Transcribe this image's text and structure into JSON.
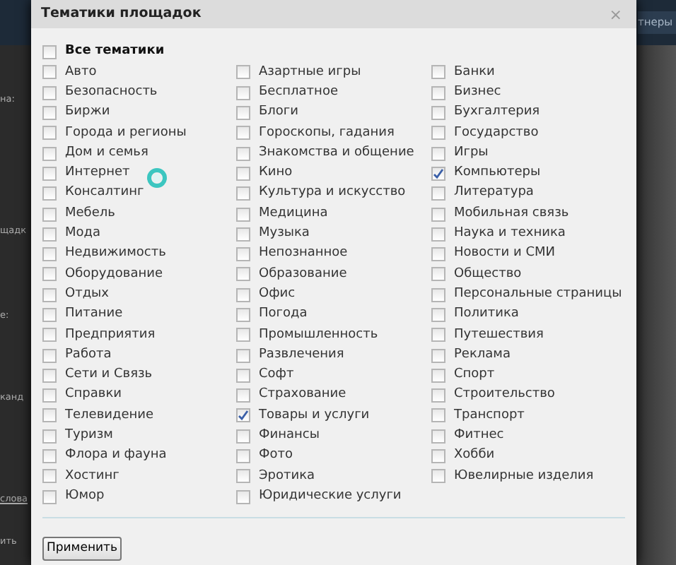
{
  "page": {
    "nav_tab": "тнеры",
    "side_labels": [
      "на:",
      "щадк",
      "е:",
      "канд",
      "слова",
      "ить"
    ]
  },
  "dialog": {
    "title": "Тематики площадок",
    "close": "×",
    "all": {
      "label": "Все тематики",
      "checked": false
    },
    "columns": [
      [
        {
          "label": "Авто",
          "checked": false
        },
        {
          "label": "Безопасность",
          "checked": false
        },
        {
          "label": "Биржи",
          "checked": false
        },
        {
          "label": "Города и регионы",
          "checked": false
        },
        {
          "label": "Дом и семья",
          "checked": false
        },
        {
          "label": "Интернет",
          "checked": false
        },
        {
          "label": "Консалтинг",
          "checked": false
        },
        {
          "label": "Мебель",
          "checked": false
        },
        {
          "label": "Мода",
          "checked": false
        },
        {
          "label": "Недвижимость",
          "checked": false
        },
        {
          "label": "Оборудование",
          "checked": false
        },
        {
          "label": "Отдых",
          "checked": false
        },
        {
          "label": "Питание",
          "checked": false
        },
        {
          "label": "Предприятия",
          "checked": false
        },
        {
          "label": "Работа",
          "checked": false
        },
        {
          "label": "Сети и Связь",
          "checked": false
        },
        {
          "label": "Справки",
          "checked": false
        },
        {
          "label": "Телевидение",
          "checked": false
        },
        {
          "label": "Туризм",
          "checked": false
        },
        {
          "label": "Флора и фауна",
          "checked": false
        },
        {
          "label": "Хостинг",
          "checked": false
        },
        {
          "label": "Юмор",
          "checked": false
        }
      ],
      [
        {
          "label": "Азартные игры",
          "checked": false
        },
        {
          "label": "Бесплатное",
          "checked": false
        },
        {
          "label": "Блоги",
          "checked": false
        },
        {
          "label": "Гороскопы, гадания",
          "checked": false
        },
        {
          "label": "Знакомства и общение",
          "checked": false
        },
        {
          "label": "Кино",
          "checked": false
        },
        {
          "label": "Культура и искусство",
          "checked": false
        },
        {
          "label": "Медицина",
          "checked": false
        },
        {
          "label": "Музыка",
          "checked": false
        },
        {
          "label": "Непознанное",
          "checked": false
        },
        {
          "label": "Образование",
          "checked": false
        },
        {
          "label": "Офис",
          "checked": false
        },
        {
          "label": "Погода",
          "checked": false
        },
        {
          "label": "Промышленность",
          "checked": false
        },
        {
          "label": "Развлечения",
          "checked": false
        },
        {
          "label": "Софт",
          "checked": false
        },
        {
          "label": "Страхование",
          "checked": false
        },
        {
          "label": "Товары и услуги",
          "checked": true
        },
        {
          "label": "Финансы",
          "checked": false
        },
        {
          "label": "Фото",
          "checked": false
        },
        {
          "label": "Эротика",
          "checked": false
        },
        {
          "label": "Юридические услуги",
          "checked": false
        }
      ],
      [
        {
          "label": "Банки",
          "checked": false
        },
        {
          "label": "Бизнес",
          "checked": false
        },
        {
          "label": "Бухгалтерия",
          "checked": false
        },
        {
          "label": "Государство",
          "checked": false
        },
        {
          "label": "Игры",
          "checked": false
        },
        {
          "label": "Компьютеры",
          "checked": true
        },
        {
          "label": "Литература",
          "checked": false
        },
        {
          "label": "Мобильная связь",
          "checked": false
        },
        {
          "label": "Наука и техника",
          "checked": false
        },
        {
          "label": "Новости и СМИ",
          "checked": false
        },
        {
          "label": "Общество",
          "checked": false
        },
        {
          "label": "Персональные страницы",
          "checked": false
        },
        {
          "label": "Политика",
          "checked": false
        },
        {
          "label": "Путешествия",
          "checked": false
        },
        {
          "label": "Реклама",
          "checked": false
        },
        {
          "label": "Спорт",
          "checked": false
        },
        {
          "label": "Строительство",
          "checked": false
        },
        {
          "label": "Транспорт",
          "checked": false
        },
        {
          "label": "Фитнес",
          "checked": false
        },
        {
          "label": "Хобби",
          "checked": false
        },
        {
          "label": "Ювелирные изделия",
          "checked": false
        }
      ]
    ],
    "apply_button": "Применить"
  }
}
